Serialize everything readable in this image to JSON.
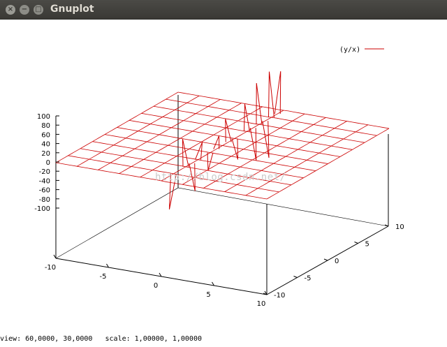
{
  "window": {
    "title": "Gnuplot"
  },
  "icons": {
    "close": "close-icon",
    "minimize": "minimize-icon",
    "maximize": "maximize-icon"
  },
  "legend": {
    "label": "(y/x)",
    "color": "#cc0000"
  },
  "watermark": "http://blog.csdn.net/",
  "status": {
    "text": "view: 60,0000, 30,0000   scale: 1,00000, 1,00000"
  },
  "chart_data": {
    "type": "surface",
    "function": "y/x",
    "series": [
      {
        "name": "(y/x)",
        "color": "#cc0000"
      }
    ],
    "xrange": [
      -10,
      10
    ],
    "yrange": [
      -10,
      10
    ],
    "zrange": [
      -100,
      100
    ],
    "x_ticks": [
      "-10",
      "-5",
      "0",
      "5",
      "10"
    ],
    "y_ticks": [
      "-10",
      "-5",
      "0",
      "5",
      "10"
    ],
    "z_ticks": [
      "100",
      "80",
      "60",
      "40",
      "20",
      "0",
      "-20",
      "-40",
      "-60",
      "-80",
      "-100"
    ],
    "view": {
      "rot_x": 60,
      "rot_z": 30,
      "scale": 1,
      "scale_z": 1
    }
  }
}
